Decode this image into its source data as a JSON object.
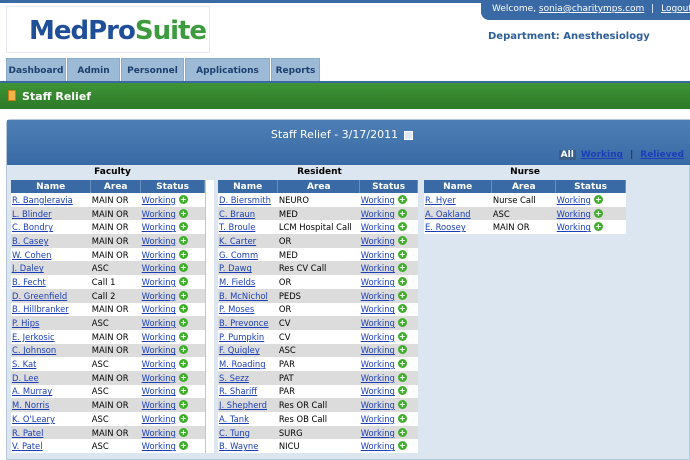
{
  "app": {
    "logo_part1": "MedPro",
    "logo_part2": "Suite",
    "welcome": "Welcome,",
    "user_email": "sonia@charitymps.com",
    "separator": "|",
    "logout": "Logout",
    "department": "Department: Anesthesiology"
  },
  "nav": {
    "tabs": [
      {
        "label": "Dashboard"
      },
      {
        "label": "Admin"
      },
      {
        "label": "Personnel"
      },
      {
        "label": "Applications"
      },
      {
        "label": "Reports"
      }
    ]
  },
  "page": {
    "title": "Staff Relief",
    "panel_title": "Staff Relief - 3/17/2011"
  },
  "filters": {
    "all": "All",
    "working": "Working",
    "relieved": "Relieved",
    "sep": "|"
  },
  "columns_header": {
    "name": "Name",
    "area": "Area",
    "status": "Status"
  },
  "faculty": {
    "title": "Faculty",
    "rows": [
      {
        "name": "R. Bangleravia",
        "area": "MAIN OR",
        "status": "Working"
      },
      {
        "name": "L. Blinder",
        "area": "MAIN OR",
        "status": "Working"
      },
      {
        "name": "C. Bondry",
        "area": "MAIN OR",
        "status": "Working"
      },
      {
        "name": "B. Casey",
        "area": "MAIN OR",
        "status": "Working"
      },
      {
        "name": "W. Cohen",
        "area": "MAIN OR",
        "status": "Working"
      },
      {
        "name": "J. Daley",
        "area": "ASC",
        "status": "Working"
      },
      {
        "name": "B. Fecht",
        "area": "Call 1",
        "status": "Working"
      },
      {
        "name": "D. Greenfield",
        "area": "Call 2",
        "status": "Working"
      },
      {
        "name": "B. Hillbranker",
        "area": "MAIN OR",
        "status": "Working"
      },
      {
        "name": "P. Hips",
        "area": "ASC",
        "status": "Working"
      },
      {
        "name": "E. Jerkosic",
        "area": "MAIN OR",
        "status": "Working"
      },
      {
        "name": "C. Johnson",
        "area": "MAIN OR",
        "status": "Working"
      },
      {
        "name": "S. Kat",
        "area": "ASC",
        "status": "Working"
      },
      {
        "name": "D. Lee",
        "area": "MAIN OR",
        "status": "Working"
      },
      {
        "name": "A. Murray",
        "area": "ASC",
        "status": "Working"
      },
      {
        "name": "M. Norris",
        "area": "MAIN OR",
        "status": "Working"
      },
      {
        "name": "K. O'Leary",
        "area": "ASC",
        "status": "Working"
      },
      {
        "name": "R. Patel",
        "area": "MAIN OR",
        "status": "Working"
      },
      {
        "name": "V. Patel",
        "area": "ASC",
        "status": "Working"
      }
    ]
  },
  "resident": {
    "title": "Resident",
    "rows": [
      {
        "name": "D. Biersmith",
        "area": "NEURO",
        "status": "Working"
      },
      {
        "name": "C. Braun",
        "area": "MED",
        "status": "Working"
      },
      {
        "name": "T. Broule",
        "area": "LCM Hospital Call",
        "status": "Working"
      },
      {
        "name": "K. Carter",
        "area": "OR",
        "status": "Working"
      },
      {
        "name": "G. Comm",
        "area": "MED",
        "status": "Working"
      },
      {
        "name": "P. Dawg",
        "area": "Res CV Call",
        "status": "Working"
      },
      {
        "name": "M. Fields",
        "area": "OR",
        "status": "Working"
      },
      {
        "name": "B. McNichol",
        "area": "PEDS",
        "status": "Working"
      },
      {
        "name": "P. Moses",
        "area": "OR",
        "status": "Working"
      },
      {
        "name": "B. Prevonce",
        "area": "CV",
        "status": "Working"
      },
      {
        "name": "P. Pumpkin",
        "area": "CV",
        "status": "Working"
      },
      {
        "name": "F. Quigley",
        "area": "ASC",
        "status": "Working"
      },
      {
        "name": "M. Roading",
        "area": "PAR",
        "status": "Working"
      },
      {
        "name": "S. Sezz",
        "area": "PAT",
        "status": "Working"
      },
      {
        "name": "R. Shariff",
        "area": "PAR",
        "status": "Working"
      },
      {
        "name": "J. Shepherd",
        "area": "Res OR Call",
        "status": "Working"
      },
      {
        "name": "A. Tank",
        "area": "Res OB Call",
        "status": "Working"
      },
      {
        "name": "C. Tung",
        "area": "SURG",
        "status": "Working"
      },
      {
        "name": "B. Wayne",
        "area": "NICU",
        "status": "Working"
      }
    ]
  },
  "nurse": {
    "title": "Nurse",
    "rows": [
      {
        "name": "R. Hyer",
        "area": "Nurse Call",
        "status": "Working"
      },
      {
        "name": "A. Oakland",
        "area": "ASC",
        "status": "Working"
      },
      {
        "name": "E. Roosey",
        "area": "MAIN OR",
        "status": "Working"
      }
    ]
  },
  "icons": {
    "add": "plus-circle-icon",
    "calendar": "calendar-icon",
    "page": "page-icon"
  },
  "colors": {
    "primary_blue": "#3a6aa5",
    "green": "#2d7a28",
    "add_green": "#3fae2a"
  }
}
